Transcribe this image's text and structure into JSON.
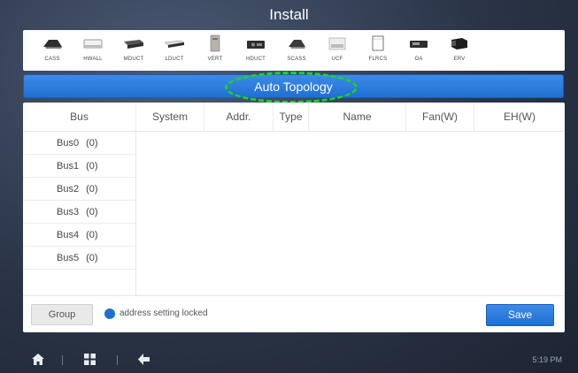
{
  "header": {
    "title": "Install"
  },
  "devices": [
    {
      "label": "CASS",
      "icon": "cassette-unit-icon"
    },
    {
      "label": "HWALL",
      "icon": "wall-mounted-unit-icon"
    },
    {
      "label": "MDUCT",
      "icon": "medium-duct-unit-icon"
    },
    {
      "label": "LDUCT",
      "icon": "low-duct-unit-icon"
    },
    {
      "label": "VERT",
      "icon": "vertical-unit-icon"
    },
    {
      "label": "HDUCT",
      "icon": "high-duct-unit-icon"
    },
    {
      "label": "SCASS",
      "icon": "small-cassette-unit-icon"
    },
    {
      "label": "UCF",
      "icon": "ceiling-floor-unit-icon"
    },
    {
      "label": "FLRCS",
      "icon": "floor-console-unit-icon"
    },
    {
      "label": "OA",
      "icon": "outdoor-air-unit-icon"
    },
    {
      "label": "ERV",
      "icon": "energy-recovery-unit-icon"
    }
  ],
  "auto_topology": {
    "label": "Auto Topology"
  },
  "table": {
    "columns": [
      "Bus",
      "System",
      "Addr.",
      "Type",
      "Name",
      "Fan(W)",
      "EH(W)"
    ],
    "buses": [
      {
        "name": "Bus0",
        "count": "(0)"
      },
      {
        "name": "Bus1",
        "count": "(0)"
      },
      {
        "name": "Bus2",
        "count": "(0)"
      },
      {
        "name": "Bus3",
        "count": "(0)"
      },
      {
        "name": "Bus4",
        "count": "(0)"
      },
      {
        "name": "Bus5",
        "count": "(0)"
      }
    ]
  },
  "footer": {
    "group_label": "Group",
    "lock_status": "address setting locked",
    "save_label": "Save"
  },
  "navbar": {
    "time": "5:19 PM",
    "icons": [
      "home-icon",
      "grid-menu-icon",
      "back-arrow-icon"
    ]
  },
  "colors": {
    "accent": "#1f6fd3",
    "highlight": "#18d81c",
    "background": "#2b3447"
  }
}
